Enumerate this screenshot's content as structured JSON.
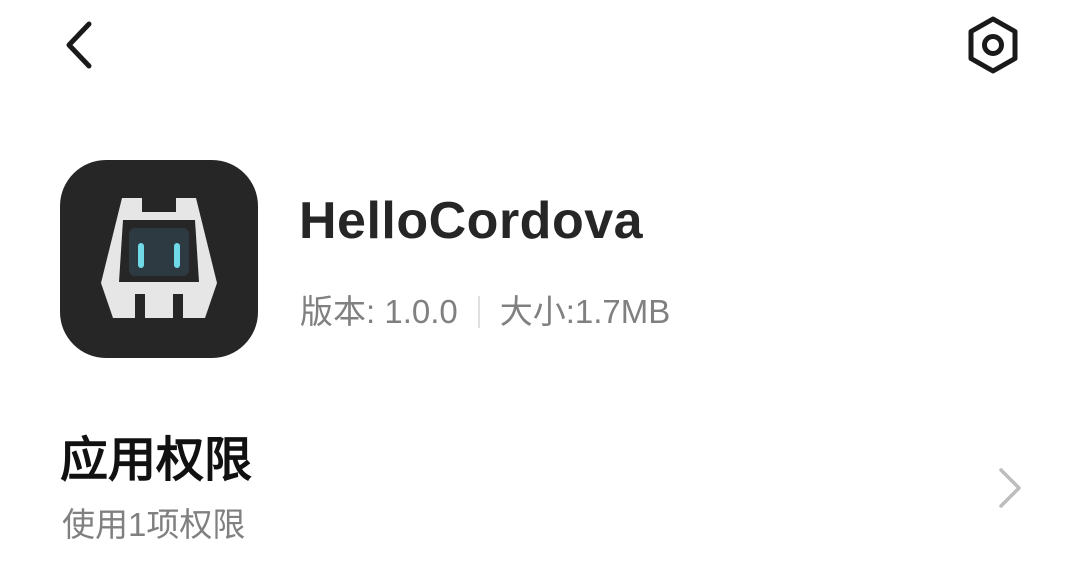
{
  "header": {
    "back_icon": "chevron-left-icon",
    "settings_icon": "hexagon-settings-icon"
  },
  "app": {
    "name": "HelloCordova",
    "icon": "cordova-robot-icon",
    "version_label": "版本: 1.0.0",
    "size_label": "大小:1.7MB"
  },
  "permissions": {
    "title": "应用权限",
    "subtitle": "使用1项权限",
    "chevron_icon": "chevron-right-icon"
  },
  "colors": {
    "icon_background": "#262626",
    "title_text": "#262626",
    "secondary_text": "#808080",
    "chevron": "#bdbdbd",
    "eye_accent": "#6fd9e8"
  }
}
